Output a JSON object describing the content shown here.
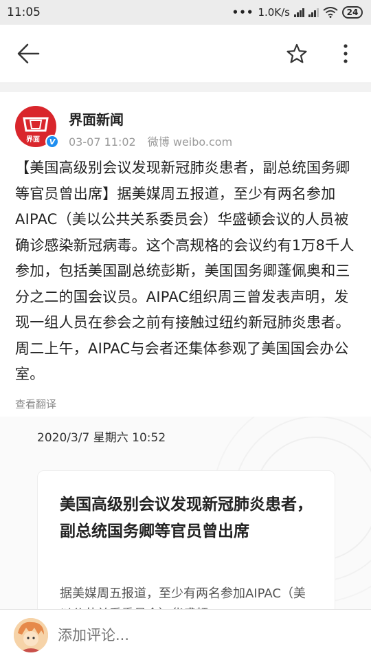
{
  "status_bar": {
    "time": "11:05",
    "net_speed": "1.0K/s",
    "battery": "24"
  },
  "toolbar": {
    "back_icon": "back-arrow-icon",
    "favorite_icon": "star-icon",
    "more_icon": "more-vertical-icon"
  },
  "author": {
    "name": "界面新闻",
    "avatar_label": "界面",
    "verified_badge": "V",
    "time": "03-07 11:02",
    "source": "微博 weibo.com"
  },
  "post": {
    "text": "【美国高级别会议发现新冠肺炎患者，副总统国务卿等官员曾出席】据美媒周五报道，至少有两名参加AIPAC（美以公共关系委员会）华盛顿会议的人员被确诊感染新冠病毒。这个高规格的会议约有1万8千人参加，包括美国副总统彭斯，美国国务卿蓬佩奥和三分之二的国会议员。AIPAC组织周三曾发表声明，发现一组人员在参会之前有接触过纽约新冠肺炎患者。周二上午，AIPAC与会者还集体参观了美国国会办公室。",
    "translate_label": "查看翻译"
  },
  "card": {
    "date": "2020/3/7 星期六 10:52",
    "title": "美国高级别会议发现新冠肺炎患者，副总统国务卿等官员曾出席",
    "excerpt": "据美媒周五报道，至少有两名参加AIPAC（美以公共关系委员会）华盛顿"
  },
  "comment": {
    "placeholder": "添加评论..."
  },
  "colors": {
    "brand_red": "#d9262c",
    "verified_blue": "#1e8ef0"
  }
}
